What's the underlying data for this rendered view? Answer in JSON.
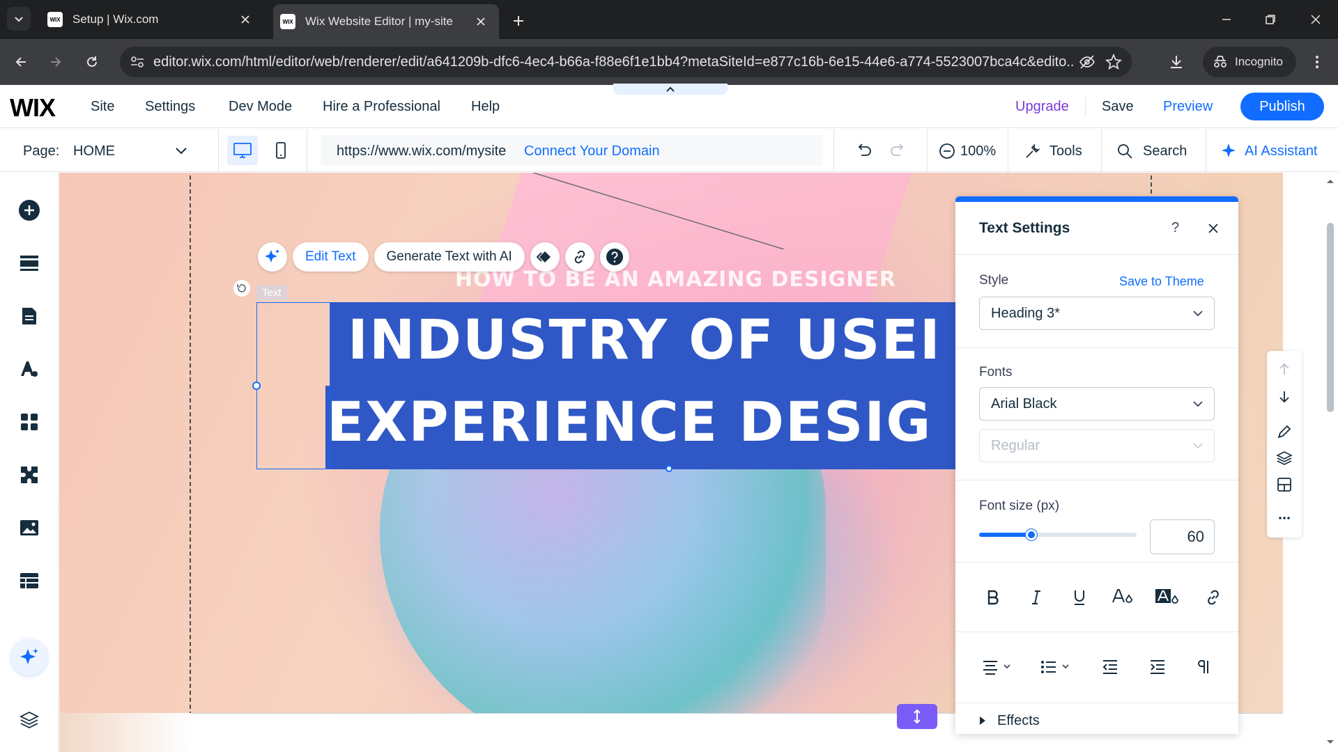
{
  "browser": {
    "tabs": [
      {
        "title": "Setup | Wix.com",
        "favicon": "WIX"
      },
      {
        "title": "Wix Website Editor | my-site",
        "favicon": "WIX"
      }
    ],
    "url": "editor.wix.com/html/editor/web/renderer/edit/a641209b-dfc6-4ec4-b66a-f88e6f1e1bb4?metaSiteId=e877c16b-6e15-44e6-a774-5523007bca4c&edito...",
    "incognito_label": "Incognito"
  },
  "wix": {
    "logo": "WIX",
    "menu": [
      "Site",
      "Settings",
      "Dev Mode",
      "Hire a Professional",
      "Help"
    ],
    "upgrade": "Upgrade",
    "save": "Save",
    "preview": "Preview",
    "publish": "Publish",
    "page_label": "Page:",
    "page_value": "HOME",
    "site_url": "https://www.wix.com/mysite",
    "connect_domain": "Connect Your Domain",
    "zoom": "100%",
    "tools": "Tools",
    "search": "Search",
    "ai_assistant": "AI Assistant",
    "accent": "#116dff"
  },
  "canvas": {
    "subtitle": "HOW TO BE AN AMAZING DESIGNER",
    "headline_line1": "INDUSTRY OF USEI",
    "headline_line2": "EXPERIENCE DESIG",
    "element_label": "Text",
    "edit_text": "Edit Text",
    "generate_text": "Generate Text with AI",
    "highlight_color": "#2f58c6"
  },
  "panel": {
    "title": "Text Settings",
    "style_label": "Style",
    "save_to_theme": "Save to Theme",
    "style_value": "Heading 3*",
    "fonts_label": "Fonts",
    "font_value": "Arial Black",
    "weight_value": "Regular",
    "font_size_label": "Font size (px)",
    "font_size_value": "60",
    "font_size_slider_fraction": 0.33,
    "effects_label": "Effects"
  }
}
